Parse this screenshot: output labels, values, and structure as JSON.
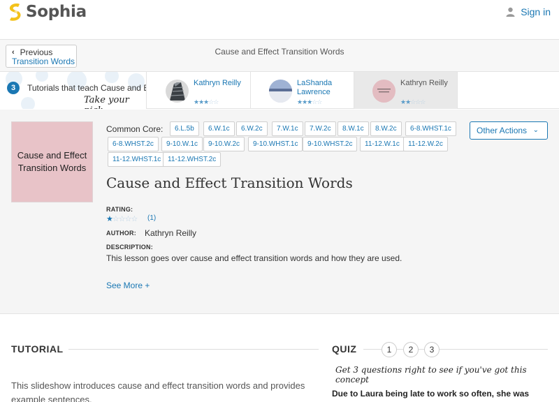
{
  "header": {
    "brand": "Sophia",
    "signin_label": "Sign in",
    "brand_color": "#f3c21b",
    "link_color": "#1a77b3"
  },
  "titlebar": {
    "prev_label": "Previous",
    "prev_link": "Transition Words",
    "page_title": "Cause and Effect Transition Words"
  },
  "tutorials": {
    "count": "3",
    "text": "Tutorials that teach Cause and Effect Transition Words",
    "pick": "Take your pick:",
    "cards": [
      {
        "name": "Kathryn Reilly",
        "rating": 3,
        "icon": "building-photo"
      },
      {
        "name": "LaShanda Lawrence",
        "rating": 3,
        "icon": "landscape-photo"
      },
      {
        "name": "Kathryn Reilly",
        "rating": 2,
        "icon": "lesson-card",
        "selected": true
      }
    ]
  },
  "lesson": {
    "thumb_text": "Cause and Effect Transition Words",
    "common_core_label": "Common Core:",
    "standards": [
      "6.L.5b",
      "6.W.1c",
      "6.W.2c",
      "7.W.1c",
      "7.W.2c",
      "8.W.1c",
      "8.W.2c",
      "6-8.WHST.1c",
      "6-8.WHST.2c",
      "9-10.W.1c",
      "9-10.W.2c",
      "9-10.WHST.1c",
      "9-10.WHST.2c",
      "11-12.W.1c",
      "11-12.W.2c",
      "11-12.WHST.1c",
      "11-12.WHST.2c"
    ],
    "other_actions": "Other Actions",
    "title": "Cause and Effect Transition Words",
    "rating_label": "RATING:",
    "rating_stars": 1,
    "rating_count": "(1)",
    "author_label": "AUTHOR:",
    "author": "Kathryn Reilly",
    "description_label": "DESCRIPTION:",
    "description": "This lesson goes over cause and effect transition words and how they are used.",
    "see_more": "See More +"
  },
  "tutorial_section": {
    "heading": "TUTORIAL",
    "text": "This slideshow introduces cause and effect transition words and provides example sentences."
  },
  "quiz": {
    "heading": "QUIZ",
    "numbers": [
      "1",
      "2",
      "3"
    ],
    "tip": "Get 3 questions right to see if you've got this concept",
    "question": "Due to Laura being late to work so often, she was"
  }
}
